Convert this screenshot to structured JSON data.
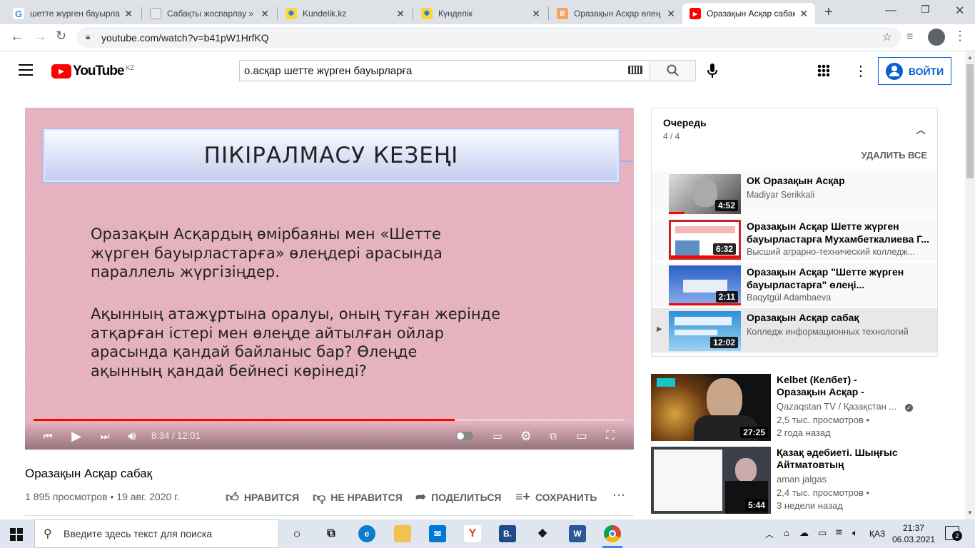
{
  "browser": {
    "tabs": [
      {
        "title": "шетте жүрген бауырла",
        "favicon": "google-g-icon",
        "active": false
      },
      {
        "title": "Сабақты жоспарлау » ",
        "favicon": "document-icon",
        "active": false
      },
      {
        "title": "Kundelik.kz",
        "favicon": "kundelik-icon",
        "active": false
      },
      {
        "title": "Күнделік",
        "favicon": "kundelik-icon",
        "active": false
      },
      {
        "title": "Оразақын Асқар өлең",
        "favicon": "presentation-icon",
        "active": false
      },
      {
        "title": "Оразақын Асқар сабақ",
        "favicon": "youtube-icon",
        "active": true
      }
    ],
    "url": "youtube.com/watch?v=b41pW1HrfKQ"
  },
  "youtube": {
    "logo_text": "YouTube",
    "region": "KZ",
    "search_value": "о.асқар шетте жүрген бауырларға",
    "signin_label": "ВОЙТИ"
  },
  "player": {
    "slide_title": "ПІКІРАЛМАСУ КЕЗЕҢІ",
    "slide_paragraph_1": [
      "Оразақын Асқардың өмірбаяны мен «Шетте",
      "жүрген бауырластарға» өлеңдері арасында",
      "параллель жүргізіңдер."
    ],
    "slide_paragraph_2": [
      "Ақынның атажұртына оралуы, оның туған жерінде",
      "атқарған істері мен өлеңде айтылған ойлар",
      "арасында қандай байланыс бар? Өлеңде",
      "ақынның қандай бейнесі көрінеді?"
    ],
    "time_current": "8:34",
    "time_total": "12:01",
    "time_display": "8:34 / 12:01",
    "progress_fraction": 0.713
  },
  "video": {
    "title": "Оразақын Асқар сабақ",
    "meta": "1 895 просмотров • 19 авг. 2020 г.",
    "actions": {
      "like": "НРАВИТСЯ",
      "dislike": "НЕ НРАВИТСЯ",
      "share": "ПОДЕЛИТЬСЯ",
      "save": "СОХРАНИТЬ"
    }
  },
  "queue": {
    "title": "Очередь",
    "position": "4 / 4",
    "clear_label": "УДАЛИТЬ ВСЕ",
    "items": [
      {
        "title": "ОК Оразақын Асқар",
        "channel": "Madiyar Serikkali",
        "duration": "4:52",
        "playing": false
      },
      {
        "title": "Оразақын Асқар Шетте жүрген бауырластарға Мухамбеткалиева Г...",
        "channel": "Высший аграрно-технический колледж...",
        "duration": "6:32",
        "playing": false
      },
      {
        "title": "Оразақын Асқар \"Шетте жүрген бауырластарға\" өлеңі...",
        "channel": "Baqytgúl Adambaeva",
        "duration": "2:11",
        "playing": false
      },
      {
        "title": "Оразақын Асқар сабақ",
        "channel": "Колледж информационных технологий",
        "duration": "12:02",
        "playing": true
      }
    ]
  },
  "recommendations": [
    {
      "title": "Kelbet (Келбет) - Оразақын Асқар - жазушы, ақын",
      "channel": "Qazaqstan TV / Қазақстан ...",
      "verified": true,
      "views": "2,5 тыс. просмотров •",
      "age": "2 года назад",
      "duration": "27:25"
    },
    {
      "title": "Қазақ әдебиеті. Шыңғыс Айтматовтың \"Алғашқы...",
      "channel": "aman jalgas",
      "verified": false,
      "views": "2,4 тыс. просмотров •",
      "age": "3 недели назад",
      "duration": "5:44"
    }
  ],
  "taskbar": {
    "search_placeholder": "Введите здесь текст для поиска",
    "language": "ҚАЗ",
    "time": "21:37",
    "date": "06.03.2021",
    "notifications": "2"
  },
  "colors": {
    "youtube_red": "#ff0000",
    "link_blue": "#065fd4",
    "slide_bg": "#e5b3bf"
  }
}
